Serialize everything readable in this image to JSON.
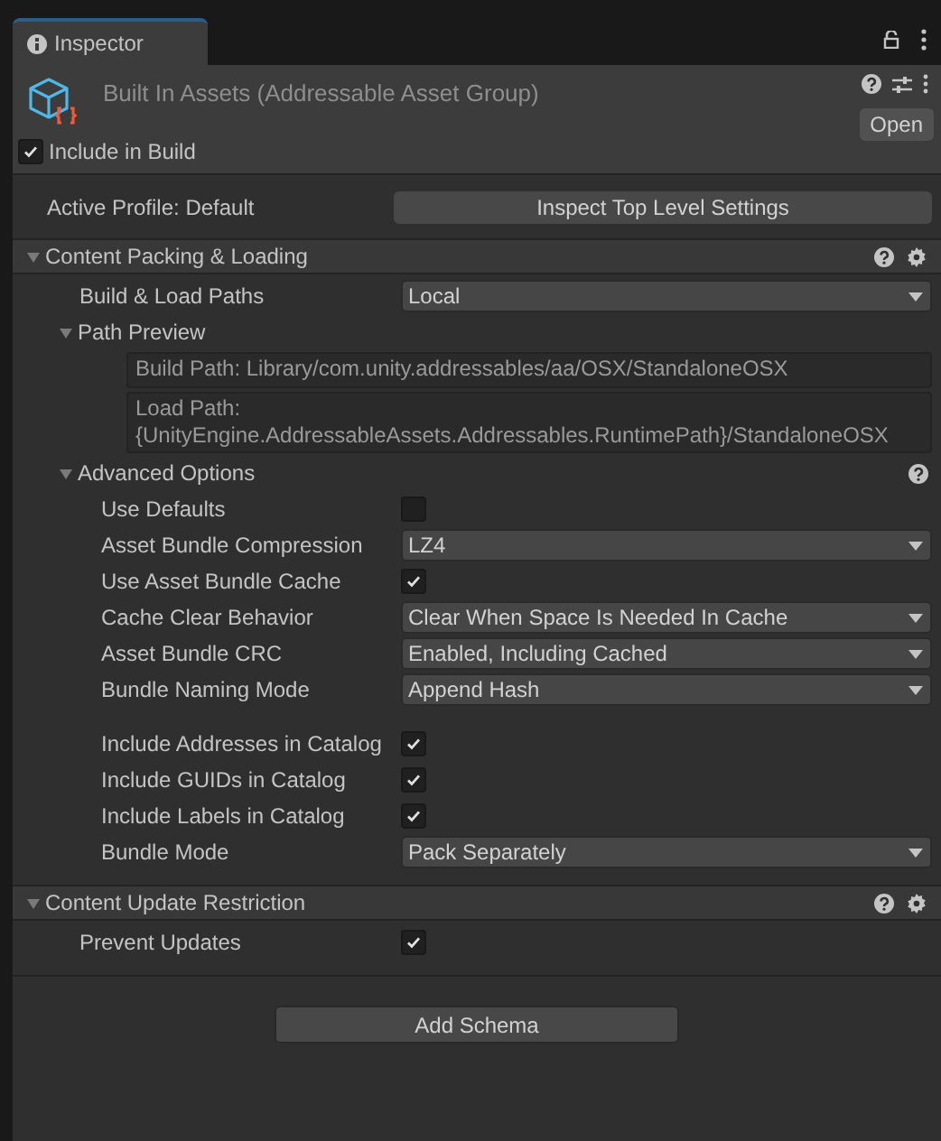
{
  "tab": {
    "label": "Inspector",
    "selected": true
  },
  "header": {
    "title": "Built In Assets (Addressable Asset Group)",
    "open_button": "Open",
    "include_in_build": {
      "label": "Include in Build",
      "checked": true
    }
  },
  "active_profile": {
    "label": "Active Profile: Default",
    "button": "Inspect Top Level Settings"
  },
  "sections": [
    {
      "title": "Content Packing & Loading",
      "expanded": true,
      "help": true,
      "settings": true,
      "rows": [
        {
          "kind": "dropdown",
          "label": "Build & Load Paths",
          "value": "Local"
        },
        {
          "kind": "foldout",
          "label": "Path Preview",
          "expanded": true,
          "help": false,
          "children": [
            {
              "kind": "path",
              "value": "Build Path: Library/com.unity.addressables/aa/OSX/StandaloneOSX"
            },
            {
              "kind": "path",
              "value": "Load Path: {UnityEngine.AddressableAssets.Addressables.RuntimePath}/StandaloneOSX"
            }
          ]
        },
        {
          "kind": "foldout",
          "label": "Advanced Options",
          "expanded": true,
          "help": true,
          "children": [
            {
              "kind": "checkbox",
              "label": "Use Defaults",
              "checked": false
            },
            {
              "kind": "dropdown",
              "label": "Asset Bundle Compression",
              "value": "LZ4"
            },
            {
              "kind": "checkbox",
              "label": "Use Asset Bundle Cache",
              "checked": true
            },
            {
              "kind": "dropdown",
              "label": "Cache Clear Behavior",
              "value": "Clear When Space Is Needed In Cache"
            },
            {
              "kind": "dropdown",
              "label": "Asset Bundle CRC",
              "value": "Enabled, Including Cached"
            },
            {
              "kind": "dropdown",
              "label": "Bundle Naming Mode",
              "value": "Append Hash"
            },
            {
              "kind": "spacer"
            },
            {
              "kind": "checkbox",
              "label": "Include Addresses in Catalog",
              "checked": true
            },
            {
              "kind": "checkbox",
              "label": "Include GUIDs in Catalog",
              "checked": true
            },
            {
              "kind": "checkbox",
              "label": "Include Labels in Catalog",
              "checked": true
            },
            {
              "kind": "dropdown",
              "label": "Bundle Mode",
              "value": "Pack Separately"
            }
          ]
        }
      ]
    },
    {
      "title": "Content Update Restriction",
      "expanded": true,
      "help": true,
      "settings": true,
      "rows": [
        {
          "kind": "checkbox",
          "label": "Prevent Updates",
          "checked": true
        }
      ]
    }
  ],
  "add_schema": "Add Schema"
}
